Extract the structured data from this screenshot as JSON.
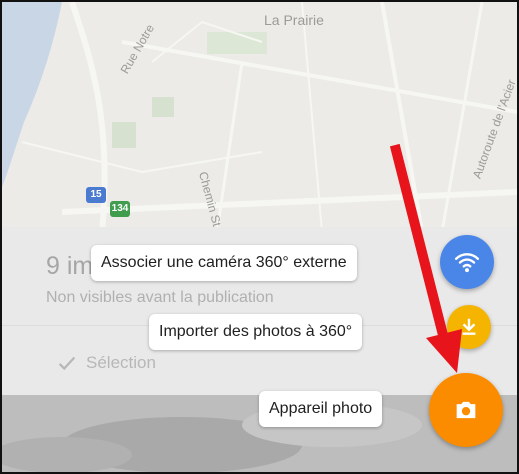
{
  "map": {
    "labels": {
      "la_prairie": "La Prairie",
      "rue_notre": "Rue Notre",
      "chemin": "Chemin St",
      "autoroute": "Autoroute de l'Acier"
    },
    "route_shields": [
      "15",
      "134"
    ]
  },
  "sheet": {
    "title": "9 im",
    "subtitle": "Non visibles avant la publication",
    "selection_label": "Sélection"
  },
  "actions": {
    "connect_camera_label": "Associer une caméra 360° externe",
    "import_photos_label": "Importer des photos à 360°",
    "camera_label": "Appareil photo"
  },
  "colors": {
    "wifi_fab": "#4a86e8",
    "import_fab": "#f4b400",
    "camera_fab": "#fb8c00",
    "annotation_arrow": "#e8141b",
    "route_15": "#4a7bd1",
    "route_134": "#3f9d4d"
  },
  "icons": {
    "wifi_fab": "wifi-icon",
    "import_fab": "download-icon",
    "camera_fab": "camera-icon",
    "selection": "checkmark-icon"
  }
}
